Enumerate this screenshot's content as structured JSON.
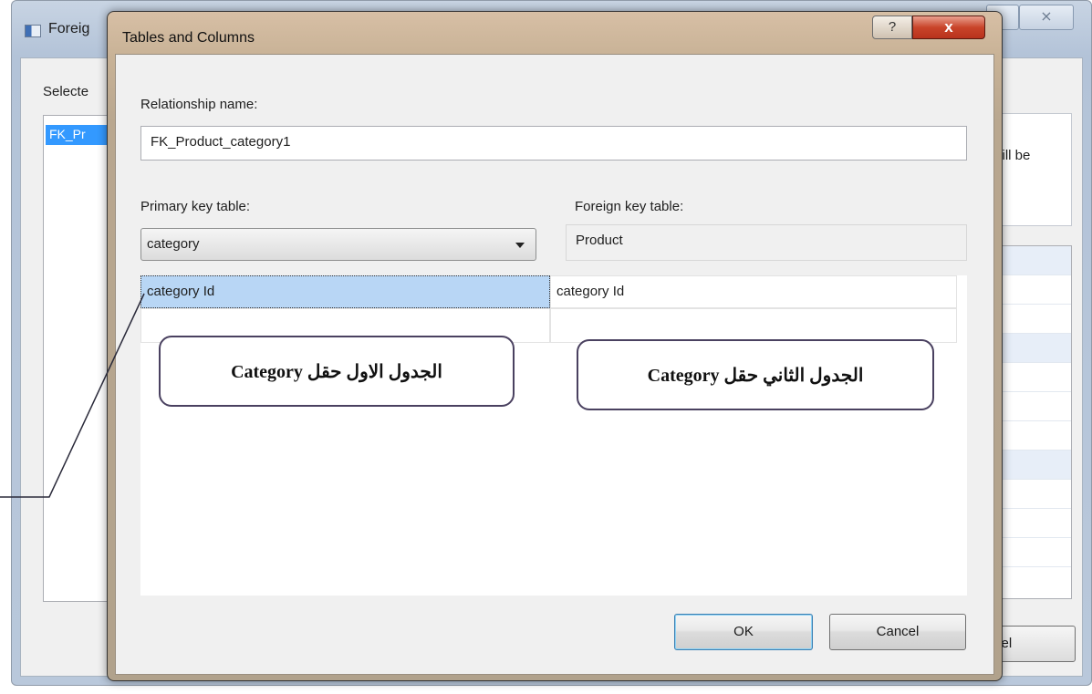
{
  "background_window": {
    "title": "Foreig",
    "close_glyph": "⨯",
    "selected_label": "Selecte",
    "list_item": "FK_Pr",
    "info_text": "vill be",
    "cancel_label": "cel"
  },
  "dialog": {
    "title": "Tables and Columns",
    "help_glyph": "?",
    "close_glyph": "x",
    "relationship_name_label": "Relationship name:",
    "relationship_name_value": "FK_Product_category1",
    "primary_key_table_label": "Primary key table:",
    "primary_key_table_value": "category",
    "foreign_key_table_label": "Foreign key table:",
    "foreign_key_table_value": "Product",
    "column_mappings": [
      {
        "primary": "category Id",
        "foreign": "category Id"
      },
      {
        "primary": "",
        "foreign": ""
      }
    ],
    "ok_label": "OK",
    "cancel_label": "Cancel"
  },
  "annotations": {
    "callout_primary": "الجدول الاول حقل Category",
    "callout_foreign": "الجدول الثاني حقل Category"
  }
}
